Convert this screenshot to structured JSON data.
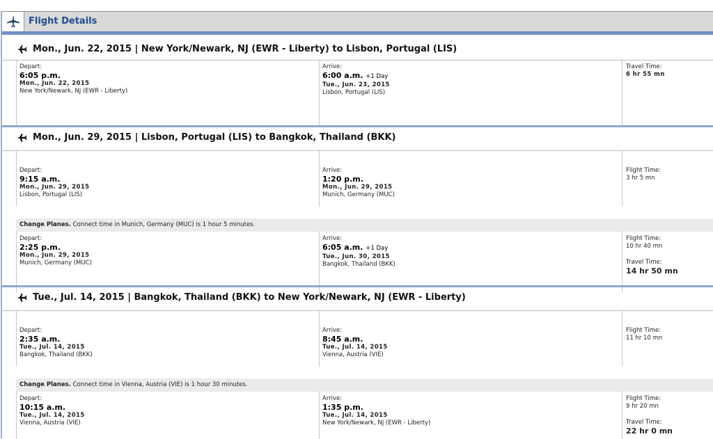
{
  "header": {
    "title": "Flight Details",
    "icon": "airplane-icon"
  },
  "segments": [
    {
      "title": "Mon., Jun. 22, 2015 | New York/Newark, NJ (EWR - Liberty) to Lisbon, Portugal (LIS)",
      "legs": [
        {
          "depart_label": "Depart:",
          "depart_time": "6:05 p.m.",
          "depart_plus": "",
          "depart_date": "Mon., Jun. 22, 2015",
          "depart_loc": "New York/Newark, NJ (EWR - Liberty)",
          "arrive_label": "Arrive:",
          "arrive_time": "6:00 a.m.",
          "arrive_plus": "+1 Day",
          "arrive_date": "Tue., Jun. 23, 2015",
          "arrive_loc": "Lisbon, Portugal (LIS)",
          "time_label": "Travel Time:",
          "time_value": "6 hr 55 mn"
        }
      ]
    },
    {
      "title": "Mon., Jun. 29, 2015 | Lisbon, Portugal (LIS) to Bangkok, Thailand (BKK)",
      "legs": [
        {
          "depart_label": "Depart:",
          "depart_time": "9:15 a.m.",
          "depart_plus": "",
          "depart_date": "Mon., Jun. 29, 2015",
          "depart_loc": "Lisbon, Portugal (LIS)",
          "arrive_label": "Arrive:",
          "arrive_time": "1:20 p.m.",
          "arrive_plus": "",
          "arrive_date": "Mon., Jun. 29, 2015",
          "arrive_loc": "Munich, Germany (MUC)",
          "time_label": "Flight Time:",
          "time_value": "3 hr 5 mn"
        },
        {
          "depart_label": "Depart:",
          "depart_time": "2:25 p.m.",
          "depart_plus": "",
          "depart_date": "Mon., Jun. 29, 2015",
          "depart_loc": "Munich, Germany (MUC)",
          "arrive_label": "Arrive:",
          "arrive_time": "6:05 a.m.",
          "arrive_plus": "+1 Day",
          "arrive_date": "Tue., Jun. 30, 2015",
          "arrive_loc": "Bangkok, Thailand (BKK)",
          "time_label": "Flight Time:",
          "time_value": "10 hr 40 mn",
          "total_label": "Travel Time:",
          "total_value": "14 hr 50 mn"
        }
      ],
      "change": {
        "label": "Change Planes.",
        "text": "Connect time in Munich, Germany (MUC) is 1 hour 5 minutes."
      }
    },
    {
      "title": "Tue., Jul. 14, 2015 | Bangkok, Thailand (BKK) to New York/Newark, NJ (EWR - Liberty)",
      "legs": [
        {
          "depart_label": "Depart:",
          "depart_time": "2:35 a.m.",
          "depart_plus": "",
          "depart_date": "Tue., Jul. 14, 2015",
          "depart_loc": "Bangkok, Thailand (BKK)",
          "arrive_label": "Arrive:",
          "arrive_time": "8:45 a.m.",
          "arrive_plus": "",
          "arrive_date": "Tue., Jul. 14, 2015",
          "arrive_loc": "Vienna, Austria (VIE)",
          "time_label": "Flight Time:",
          "time_value": "11 hr 10 mn"
        },
        {
          "depart_label": "Depart:",
          "depart_time": "10:15 a.m.",
          "depart_plus": "",
          "depart_date": "Tue., Jul. 14, 2015",
          "depart_loc": "Vienna, Austria (VIE)",
          "arrive_label": "Arrive:",
          "arrive_time": "1:35 p.m.",
          "arrive_plus": "",
          "arrive_date": "Tue., Jul. 14, 2015",
          "arrive_loc": "New York/Newark, NJ (EWR - Liberty)",
          "time_label": "Flight Time:",
          "time_value": "9 hr 20 mn",
          "total_label": "Travel Time:",
          "total_value": "22 hr 0 mn"
        }
      ],
      "change": {
        "label": "Change Planes.",
        "text": "Connect time in Vienna, Austria (VIE) is 1 hour 30 minutes."
      }
    }
  ],
  "colors": {
    "header_bg": "#d9d9d9",
    "accent_blue": "#6f8fbf",
    "title_blue": "#1f4c8f",
    "change_bg": "#ebebeb"
  }
}
